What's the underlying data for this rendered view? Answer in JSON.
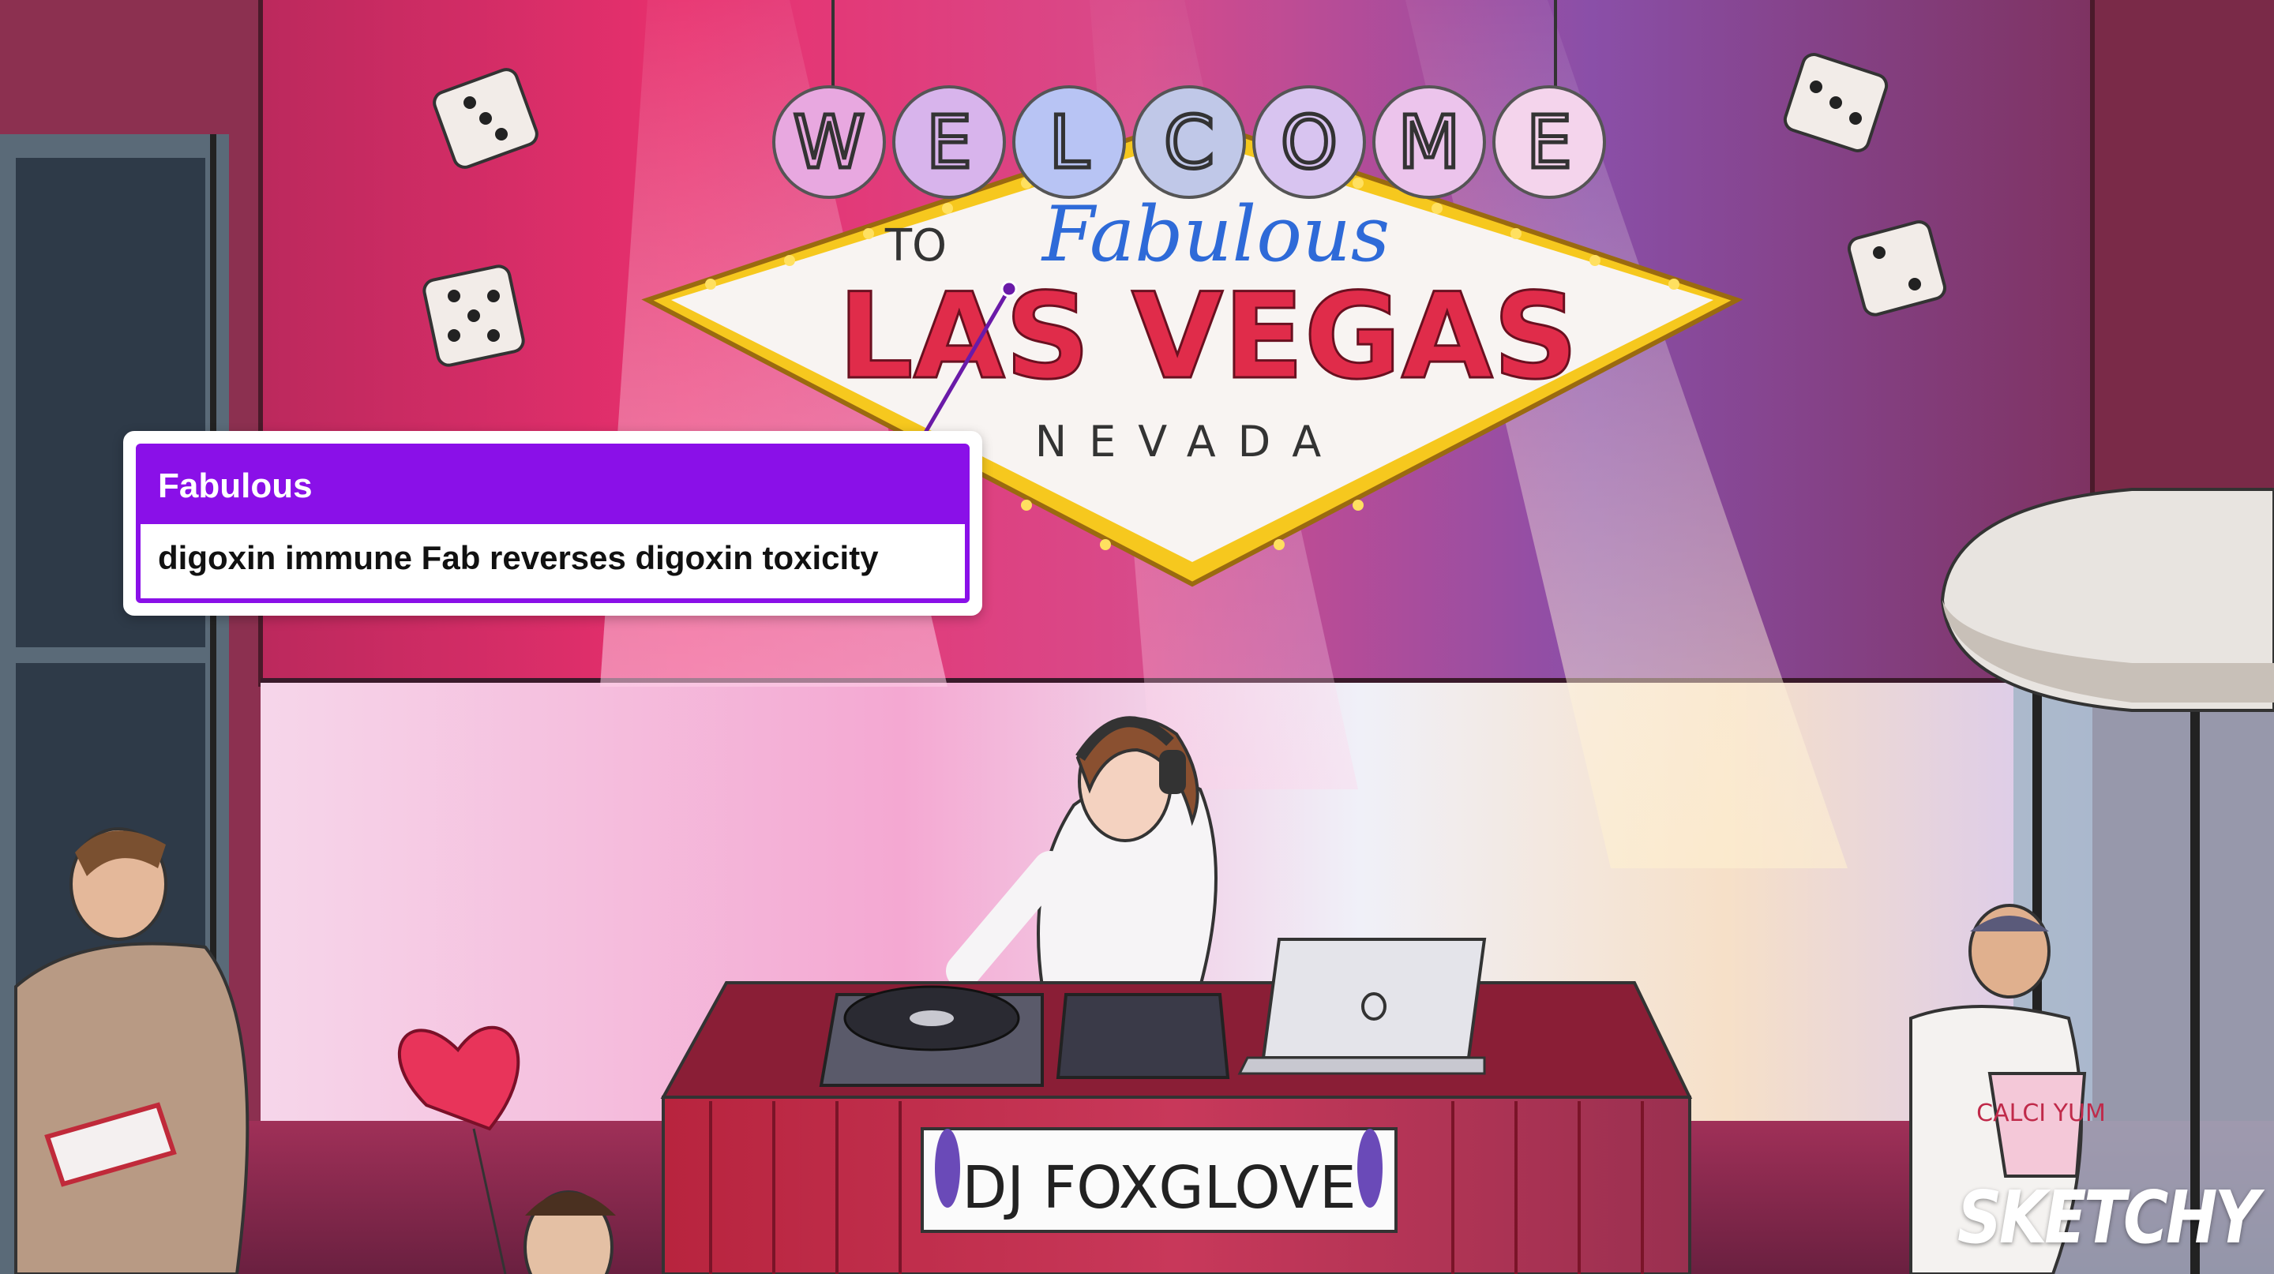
{
  "sign": {
    "welcome_letters": [
      "W",
      "E",
      "L",
      "C",
      "O",
      "M",
      "E"
    ],
    "to": "TO",
    "fabulous": "Fabulous",
    "las_vegas": "LAS VEGAS",
    "nevada": "NEVADA"
  },
  "callout": {
    "title": "Fabulous",
    "body": "digoxin immune Fab reverses digoxin toxicity",
    "header_color": "#8a10e8"
  },
  "dj_banner": "DJ FOXGLOVE",
  "popcorn_label": "CALCI YUM",
  "brand_logo": "SKETCHY"
}
